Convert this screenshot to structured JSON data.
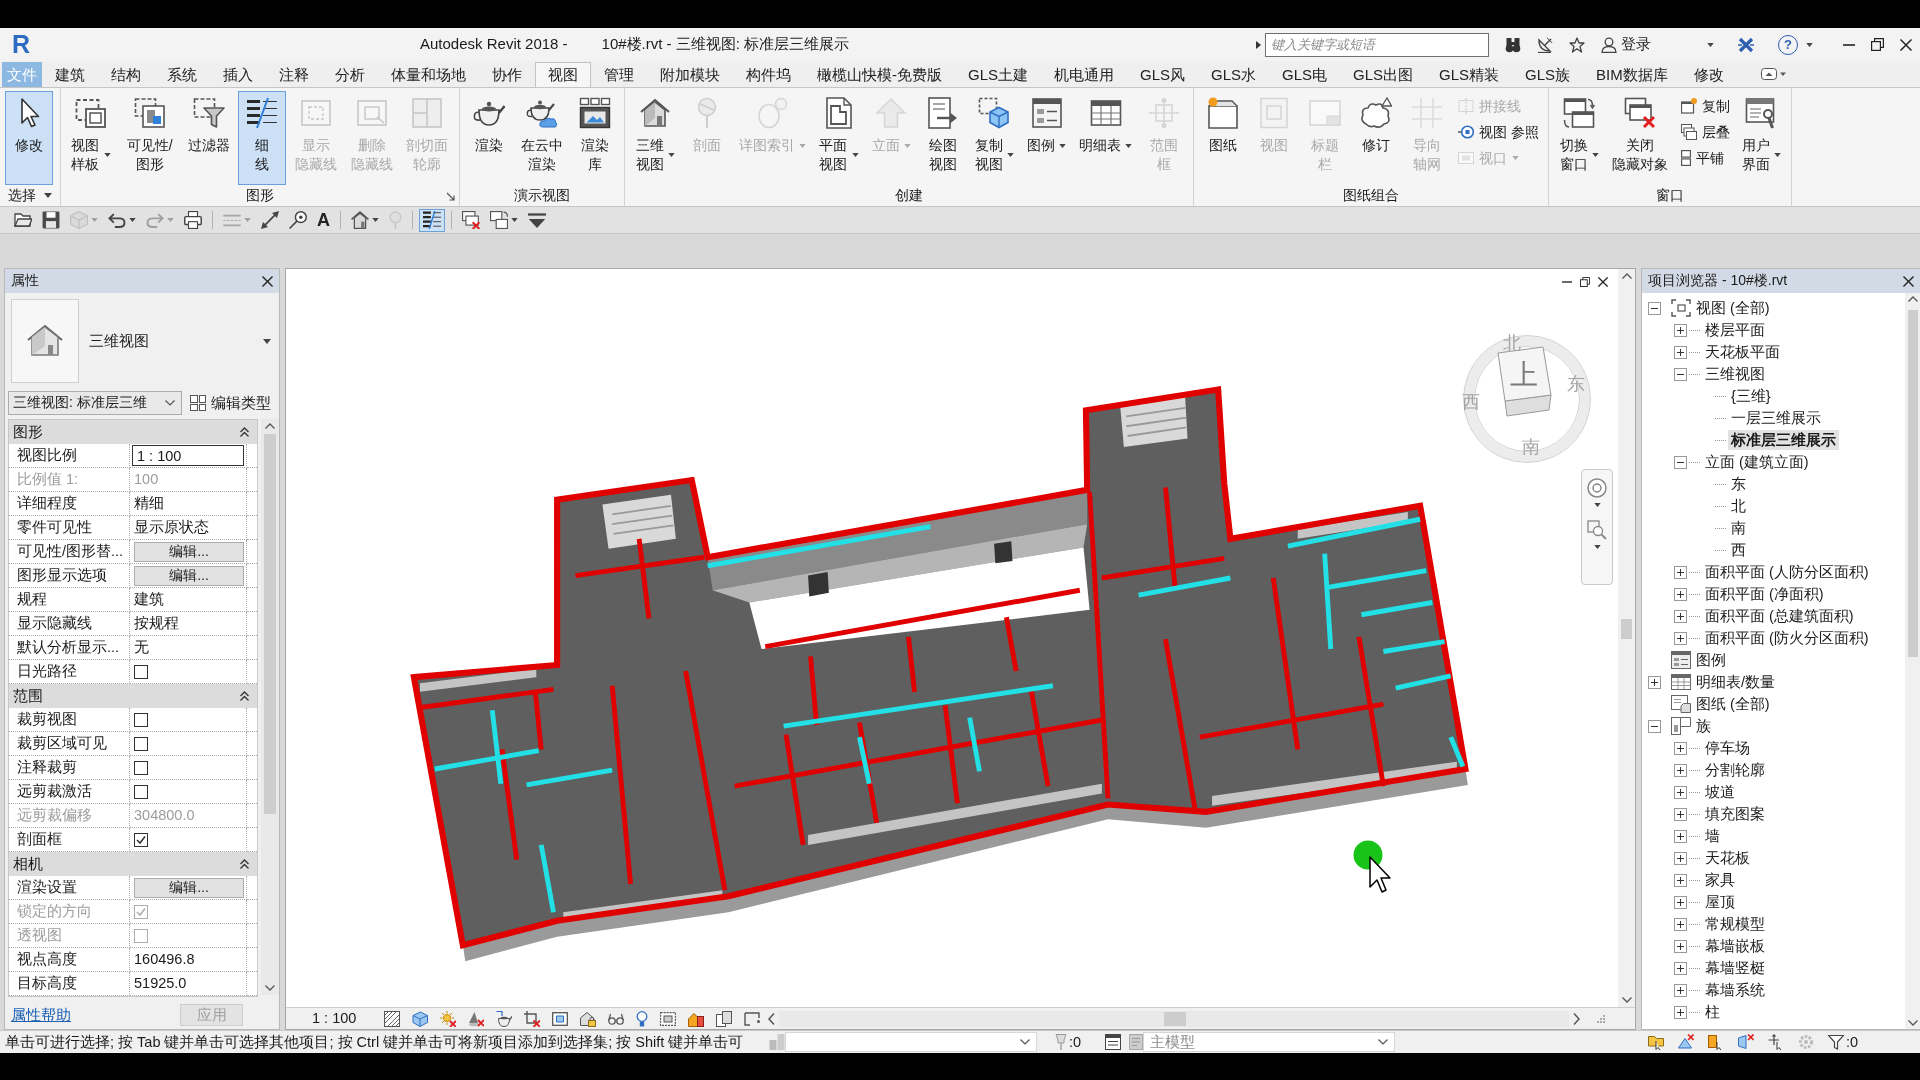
{
  "title_bar": {
    "logo": "R",
    "app_title": "Autodesk Revit 2018 -",
    "document_title": "10#楼.rvt - 三维视图: 标准层三维展示",
    "search": {
      "placeholder": "键入关键字或短语"
    },
    "sign_in": "登录",
    "help": "?"
  },
  "tabs": [
    {
      "label": "文件",
      "selected": false
    },
    {
      "label": "建筑",
      "selected": false
    },
    {
      "label": "结构",
      "selected": false
    },
    {
      "label": "系统",
      "selected": false
    },
    {
      "label": "插入",
      "selected": false
    },
    {
      "label": "注释",
      "selected": false
    },
    {
      "label": "分析",
      "selected": false
    },
    {
      "label": "体量和场地",
      "selected": false
    },
    {
      "label": "协作",
      "selected": false
    },
    {
      "label": "视图",
      "selected": true
    },
    {
      "label": "管理",
      "selected": false
    },
    {
      "label": "附加模块",
      "selected": false
    },
    {
      "label": "构件坞",
      "selected": false
    },
    {
      "label": "橄榄山快模-免费版",
      "selected": false
    },
    {
      "label": "GLS土建",
      "selected": false
    },
    {
      "label": "机电通用",
      "selected": false
    },
    {
      "label": "GLS风",
      "selected": false
    },
    {
      "label": "GLS水",
      "selected": false
    },
    {
      "label": "GLS电",
      "selected": false
    },
    {
      "label": "GLS出图",
      "selected": false
    },
    {
      "label": "GLS精装",
      "selected": false
    },
    {
      "label": "GLS族",
      "selected": false
    },
    {
      "label": "BIM数据库",
      "selected": false
    },
    {
      "label": "修改",
      "selected": false
    }
  ],
  "ribbon": {
    "panels": [
      {
        "label": "选择",
        "menu": true,
        "launcher": false,
        "items": [
          {
            "kind": "large",
            "label": "修改",
            "active": true,
            "disabled": false,
            "dropdown": false
          }
        ]
      },
      {
        "label": "图形",
        "menu": false,
        "launcher": true,
        "items": [
          {
            "kind": "large",
            "label": "视图样板",
            "active": false,
            "disabled": false,
            "dropdown": true
          },
          {
            "kind": "large",
            "label": "可见性/图形",
            "active": false,
            "disabled": false,
            "dropdown": false
          },
          {
            "kind": "large",
            "label": "过滤器",
            "active": false,
            "disabled": false,
            "dropdown": false
          },
          {
            "kind": "large",
            "label": "细线",
            "active": true,
            "disabled": false,
            "dropdown": false
          },
          {
            "kind": "large",
            "label": "显示隐藏线",
            "active": false,
            "disabled": true,
            "dropdown": false
          },
          {
            "kind": "large",
            "label": "删除隐藏线",
            "active": false,
            "disabled": true,
            "dropdown": false
          },
          {
            "kind": "large",
            "label": "剖切面轮廓",
            "active": false,
            "disabled": true,
            "dropdown": false
          }
        ]
      },
      {
        "label": "演示视图",
        "menu": false,
        "launcher": false,
        "items": [
          {
            "kind": "large",
            "label": "渲染",
            "active": false,
            "disabled": false,
            "dropdown": false
          },
          {
            "kind": "large",
            "label": "在云中渲染",
            "active": false,
            "disabled": false,
            "dropdown": false
          },
          {
            "kind": "large",
            "label": "渲染库",
            "active": false,
            "disabled": false,
            "dropdown": false
          }
        ]
      },
      {
        "label": "创建",
        "menu": false,
        "launcher": false,
        "items": [
          {
            "kind": "large",
            "label": "三维视图",
            "active": false,
            "disabled": false,
            "dropdown": true
          },
          {
            "kind": "large",
            "label": "剖面",
            "active": false,
            "disabled": true,
            "dropdown": false
          },
          {
            "kind": "large",
            "label": "详图索引",
            "active": false,
            "disabled": true,
            "dropdown": true
          },
          {
            "kind": "large",
            "label": "平面视图",
            "active": false,
            "disabled": false,
            "dropdown": true
          },
          {
            "kind": "large",
            "label": "立面",
            "active": false,
            "disabled": true,
            "dropdown": true
          },
          {
            "kind": "large",
            "label": "绘图视图",
            "active": false,
            "disabled": false,
            "dropdown": false
          },
          {
            "kind": "large",
            "label": "复制视图",
            "active": false,
            "disabled": false,
            "dropdown": true
          },
          {
            "kind": "large",
            "label": "图例",
            "active": false,
            "disabled": false,
            "dropdown": true
          },
          {
            "kind": "large",
            "label": "明细表",
            "active": false,
            "disabled": false,
            "dropdown": true
          },
          {
            "kind": "large",
            "label": "范围框",
            "active": false,
            "disabled": true,
            "dropdown": false
          }
        ]
      },
      {
        "label": "图纸组合",
        "menu": false,
        "launcher": false,
        "items": [
          {
            "kind": "large",
            "label": "图纸",
            "active": false,
            "disabled": false,
            "dropdown": false
          },
          {
            "kind": "large",
            "label": "视图",
            "active": false,
            "disabled": true,
            "dropdown": false
          },
          {
            "kind": "large",
            "label": "标题栏",
            "active": false,
            "disabled": true,
            "dropdown": false
          },
          {
            "kind": "large",
            "label": "修订",
            "active": false,
            "disabled": false,
            "dropdown": false
          },
          {
            "kind": "large",
            "label": "导向轴网",
            "active": false,
            "disabled": true,
            "dropdown": false
          },
          {
            "kind": "stack",
            "buttons": [
              {
                "label": "拼接线",
                "disabled": true,
                "dropdown": false
              },
              {
                "label": "视图 参照",
                "disabled": false,
                "dropdown": false
              },
              {
                "label": "视口",
                "disabled": true,
                "dropdown": true
              }
            ]
          }
        ]
      },
      {
        "label": "窗口",
        "menu": false,
        "launcher": false,
        "items": [
          {
            "kind": "large",
            "label": "切换窗口",
            "active": false,
            "disabled": false,
            "dropdown": true
          },
          {
            "kind": "large",
            "label": "关闭隐藏对象",
            "active": false,
            "disabled": false,
            "dropdown": false
          },
          {
            "kind": "stack",
            "buttons": [
              {
                "label": "复制",
                "disabled": false,
                "dropdown": false
              },
              {
                "label": "层叠",
                "disabled": false,
                "dropdown": false
              },
              {
                "label": "平铺",
                "disabled": false,
                "dropdown": false
              }
            ]
          },
          {
            "kind": "large",
            "label": "用户界面",
            "active": false,
            "disabled": false,
            "dropdown": true
          }
        ]
      }
    ]
  },
  "quick_access": [
    {
      "active": false,
      "disabled": false,
      "dropdown": false
    },
    {
      "active": false,
      "disabled": false,
      "dropdown": false
    },
    {
      "active": false,
      "disabled": true,
      "dropdown": true
    },
    {
      "active": false,
      "disabled": false,
      "dropdown": true
    },
    {
      "active": false,
      "disabled": true,
      "dropdown": true
    },
    {
      "active": false,
      "disabled": false,
      "dropdown": false
    },
    {
      "active": false,
      "disabled": true,
      "dropdown": true
    },
    {
      "active": false,
      "disabled": false,
      "dropdown": false
    },
    {
      "active": false,
      "disabled": false,
      "dropdown": false
    },
    {
      "label": "A",
      "active": false,
      "disabled": false,
      "dropdown": false
    },
    {
      "active": false,
      "disabled": false,
      "dropdown": true
    },
    {
      "active": false,
      "disabled": true,
      "dropdown": false
    },
    {
      "active": true,
      "disabled": false,
      "dropdown": false
    },
    {
      "active": false,
      "disabled": false,
      "dropdown": false
    },
    {
      "active": false,
      "disabled": false,
      "dropdown": true
    },
    {
      "active": false,
      "disabled": false,
      "dropdown": false
    }
  ],
  "properties": {
    "title": "属性",
    "type_name": "三维视图",
    "instance": "三维视图: 标准层三维",
    "edit_type": "编辑类型",
    "groups": [
      {
        "label": "图形",
        "expanded": true,
        "rows": [
          {
            "label": "视图比例",
            "kind": "input",
            "value": "1 : 100",
            "disabled": false
          },
          {
            "label": "比例值 1:",
            "kind": "text",
            "value": "100",
            "disabled": true
          },
          {
            "label": "详细程度",
            "kind": "text",
            "value": "精细",
            "disabled": false
          },
          {
            "label": "零件可见性",
            "kind": "text",
            "value": "显示原状态",
            "disabled": false
          },
          {
            "label": "可见性/图形替...",
            "kind": "button",
            "value": "编辑...",
            "disabled": false
          },
          {
            "label": "图形显示选项",
            "kind": "button",
            "value": "编辑...",
            "disabled": false
          },
          {
            "label": "规程",
            "kind": "text",
            "value": "建筑",
            "disabled": false
          },
          {
            "label": "显示隐藏线",
            "kind": "text",
            "value": "按规程",
            "disabled": false
          },
          {
            "label": "默认分析显示...",
            "kind": "text",
            "value": "无",
            "disabled": false
          },
          {
            "label": "日光路径",
            "kind": "checkbox",
            "checked": false,
            "disabled": false
          }
        ]
      },
      {
        "label": "范围",
        "expanded": true,
        "rows": [
          {
            "label": "裁剪视图",
            "kind": "checkbox",
            "checked": false,
            "disabled": false
          },
          {
            "label": "裁剪区域可见",
            "kind": "checkbox",
            "checked": false,
            "disabled": false
          },
          {
            "label": "注释裁剪",
            "kind": "checkbox",
            "checked": false,
            "disabled": false
          },
          {
            "label": "远剪裁激活",
            "kind": "checkbox",
            "checked": false,
            "disabled": false
          },
          {
            "label": "远剪裁偏移",
            "kind": "text",
            "value": "304800.0",
            "disabled": true
          },
          {
            "label": "剖面框",
            "kind": "checkbox",
            "checked": true,
            "disabled": false
          }
        ]
      },
      {
        "label": "相机",
        "expanded": true,
        "rows": [
          {
            "label": "渲染设置",
            "kind": "button",
            "value": "编辑...",
            "disabled": false
          },
          {
            "label": "锁定的方向",
            "kind": "checkbox",
            "checked": true,
            "disabled": true
          },
          {
            "label": "透视图",
            "kind": "checkbox",
            "checked": false,
            "disabled": true
          },
          {
            "label": "视点高度",
            "kind": "text",
            "value": "160496.8",
            "disabled": false
          },
          {
            "label": "目标高度",
            "kind": "text",
            "value": "51925.0",
            "disabled": false
          }
        ]
      }
    ],
    "help_link": "属性帮助",
    "apply": {
      "label": "应用",
      "disabled": true
    }
  },
  "view": {
    "viewcube": {
      "top_face": "上",
      "compass": [
        "北",
        "东",
        "南",
        "西"
      ]
    },
    "scale": "1 : 100"
  },
  "project_browser": {
    "title": "项目浏览器 - 10#楼.rvt",
    "tree": [
      {
        "label": "视图 (全部)",
        "expanded": true,
        "selected": false,
        "children": [
          {
            "label": "楼层平面",
            "expanded": false,
            "selected": false
          },
          {
            "label": "天花板平面",
            "expanded": false,
            "selected": false
          },
          {
            "label": "三维视图",
            "expanded": true,
            "selected": false,
            "children": [
              {
                "label": "{三维}",
                "selected": false
              },
              {
                "label": "一层三维展示",
                "selected": false
              },
              {
                "label": "标准层三维展示",
                "selected": true
              }
            ]
          },
          {
            "label": "立面 (建筑立面)",
            "expanded": true,
            "selected": false,
            "children": [
              {
                "label": "东",
                "selected": false
              },
              {
                "label": "北",
                "selected": false
              },
              {
                "label": "南",
                "selected": false
              },
              {
                "label": "西",
                "selected": false
              }
            ]
          },
          {
            "label": "面积平面 (人防分区面积)",
            "expanded": false,
            "selected": false
          },
          {
            "label": "面积平面 (净面积)",
            "expanded": false,
            "selected": false
          },
          {
            "label": "面积平面 (总建筑面积)",
            "expanded": false,
            "selected": false
          },
          {
            "label": "面积平面 (防火分区面积)",
            "expanded": false,
            "selected": false
          }
        ]
      },
      {
        "label": "图例",
        "selected": false
      },
      {
        "label": "明细表/数量",
        "expanded": false,
        "selected": false
      },
      {
        "label": "图纸 (全部)",
        "selected": false
      },
      {
        "label": "族",
        "expanded": true,
        "selected": false,
        "children": [
          {
            "label": "停车场",
            "expanded": false,
            "selected": false
          },
          {
            "label": "分割轮廓",
            "expanded": false,
            "selected": false
          },
          {
            "label": "坡道",
            "expanded": false,
            "selected": false
          },
          {
            "label": "填充图案",
            "expanded": false,
            "selected": false
          },
          {
            "label": "墙",
            "expanded": false,
            "selected": false
          },
          {
            "label": "天花板",
            "expanded": false,
            "selected": false
          },
          {
            "label": "家具",
            "expanded": false,
            "selected": false
          },
          {
            "label": "屋顶",
            "expanded": false,
            "selected": false
          },
          {
            "label": "常规模型",
            "expanded": false,
            "selected": false
          },
          {
            "label": "幕墙嵌板",
            "expanded": false,
            "selected": false
          },
          {
            "label": "幕墙竖梃",
            "expanded": false,
            "selected": false
          },
          {
            "label": "幕墙系统",
            "expanded": false,
            "selected": false
          },
          {
            "label": "柱",
            "expanded": false,
            "selected": false
          }
        ]
      }
    ]
  },
  "status_bar": {
    "message": "单击可进行选择; 按 Tab 键并单击可选择其他项目; 按 Ctrl 键并单击可将新项目添加到选择集; 按 Shift 键并单击可",
    "counters": [
      ":0",
      ":0"
    ],
    "model": "主模型"
  }
}
